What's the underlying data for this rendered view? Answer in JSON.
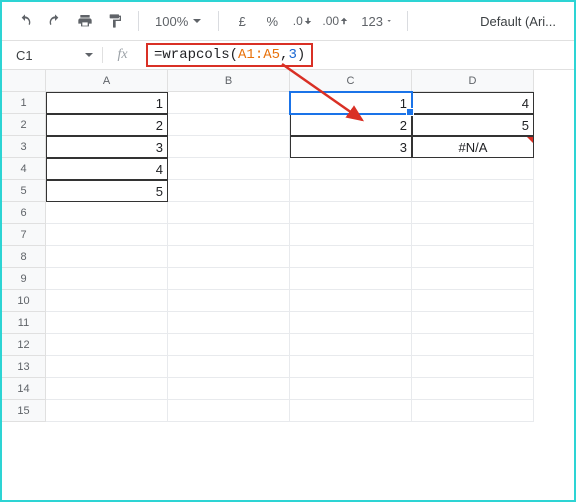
{
  "toolbar": {
    "zoom": "100%",
    "currency": "£",
    "percent": "%",
    "dec_dec": ".0",
    "dec_inc": ".00",
    "more_formats": "123",
    "font": "Default (Ari..."
  },
  "formula_bar": {
    "cell_ref": "C1",
    "formula_prefix": "=wrapcols(",
    "formula_range": "A1:A5",
    "formula_comma": ",",
    "formula_arg2": "3",
    "formula_suffix": ")"
  },
  "columns": [
    "A",
    "B",
    "C",
    "D"
  ],
  "row_count": 15,
  "cells": {
    "A1": "1",
    "A2": "2",
    "A3": "3",
    "A4": "4",
    "A5": "5",
    "C1": "1",
    "C2": "2",
    "C3": "3",
    "D1": "4",
    "D2": "5",
    "D3": "#N/A"
  }
}
